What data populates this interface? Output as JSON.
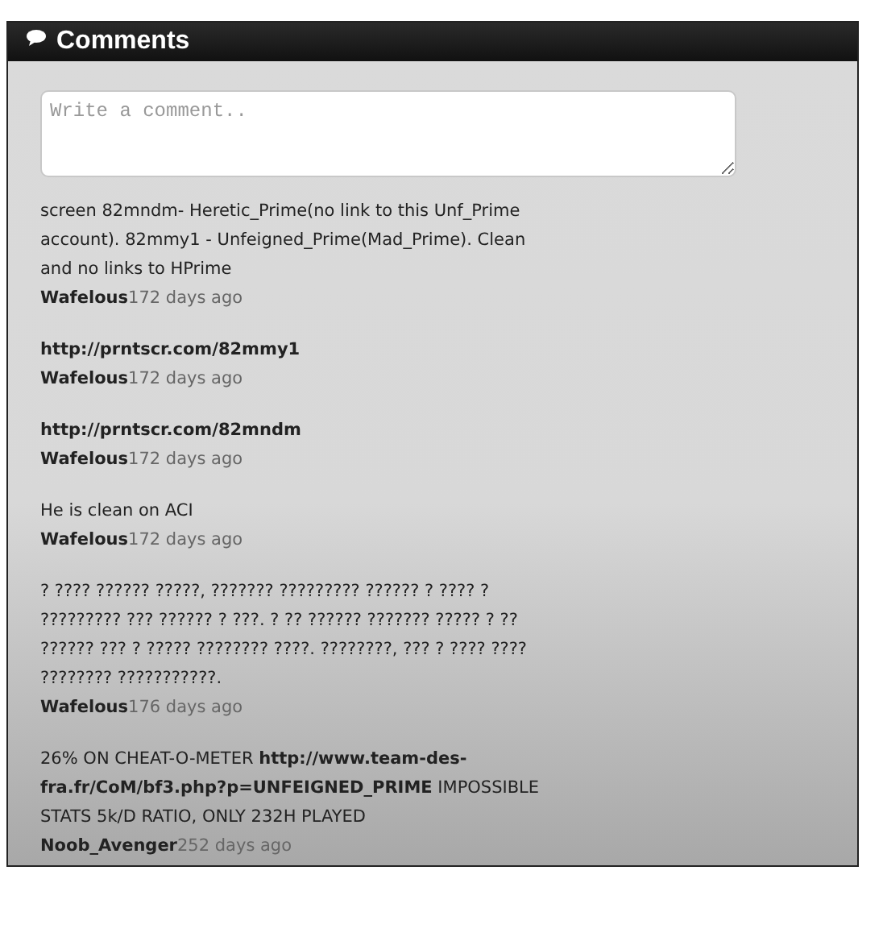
{
  "panel": {
    "title": "Comments"
  },
  "comment_box": {
    "placeholder": "Write a comment.."
  },
  "comments": [
    {
      "kind": "text",
      "text": "screen 82mndm- Heretic_Prime(no link to this Unf_Prime account). 82mmy1 - Unfeigned_Prime(Mad_Prime). Clean and no links to HPrime",
      "author": "Wafelous",
      "time": "172 days ago"
    },
    {
      "kind": "link",
      "text": "http://prntscr.com/82mmy1",
      "author": "Wafelous",
      "time": "172 days ago"
    },
    {
      "kind": "link",
      "text": "http://prntscr.com/82mndm",
      "author": "Wafelous",
      "time": "172 days ago"
    },
    {
      "kind": "text",
      "text": "He is clean on ACI",
      "author": "Wafelous",
      "time": "172 days ago"
    },
    {
      "kind": "text",
      "text": "? ???? ?????? ?????, ??????? ????????? ?????? ? ???? ? ????????? ??? ?????? ? ???. ? ?? ?????? ??????? ????? ? ?? ?????? ??? ? ????? ???????? ????. ????????, ??? ? ???? ???? ???????? ???????????.",
      "author": "Wafelous",
      "time": "176 days ago"
    },
    {
      "kind": "text",
      "text": "26% ON CHEAT-O-METER **http://www.team-des-fra.fr/CoM/bf3.php?p=UNFEIGNED_PRIME** IMPOSSIBLE STATS 5k/D RATIO, ONLY 232H PLAYED",
      "author": "Noob_Avenger",
      "time": "252 days ago"
    }
  ]
}
